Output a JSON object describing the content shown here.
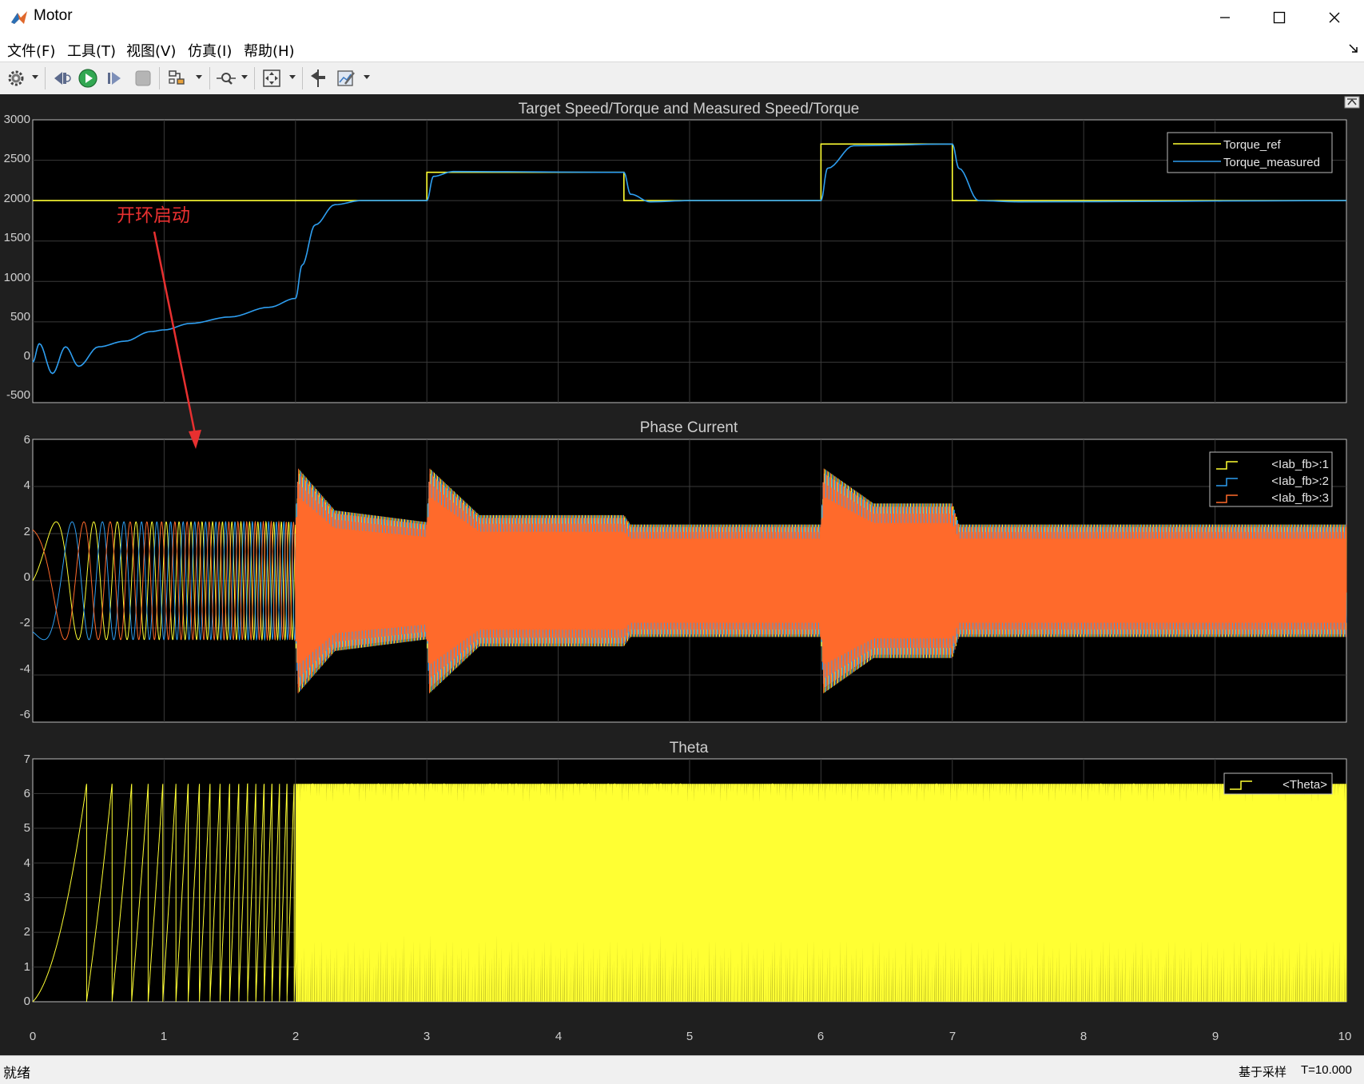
{
  "window": {
    "title": "Motor",
    "minimize_icon": "minimize-icon",
    "maximize_icon": "maximize-icon",
    "close_icon": "close-icon"
  },
  "menu": [
    "文件(F)",
    "工具(T)",
    "视图(V)",
    "仿真(I)",
    "帮助(H)"
  ],
  "toolbar": {
    "icons": [
      "gear-icon",
      "step-back-icon",
      "run-icon",
      "step-forward-icon",
      "stop-icon",
      "highlight-icon",
      "zoom-icon",
      "fit-view-icon",
      "cursor-icon",
      "style-icon"
    ]
  },
  "annotation": {
    "text": "开环启动",
    "color": "#e83030"
  },
  "plots": [
    {
      "title": "Target Speed/Torque and Measured Speed/Torque",
      "ylim": [
        -500,
        3000
      ],
      "yticks": [
        "3000",
        "2500",
        "2000",
        "1500",
        "1000",
        "500",
        "0",
        "-500"
      ],
      "legend": [
        {
          "label": "Torque_ref",
          "color": "#ffff33"
        },
        {
          "label": "Torque_measured",
          "color": "#2e9ef0"
        }
      ]
    },
    {
      "title": "Phase Current",
      "ylim": [
        -6,
        6
      ],
      "yticks": [
        "6",
        "4",
        "2",
        "0",
        "-2",
        "-4",
        "-6"
      ],
      "legend": [
        {
          "label": "<Iab_fb>:1",
          "color": "#ffff33"
        },
        {
          "label": "<Iab_fb>:2",
          "color": "#2e9ef0"
        },
        {
          "label": "<Iab_fb>:3",
          "color": "#ff6a2b"
        }
      ]
    },
    {
      "title": "Theta",
      "ylim": [
        0,
        7
      ],
      "yticks": [
        "7",
        "6",
        "5",
        "4",
        "3",
        "2",
        "1",
        "0"
      ],
      "legend": [
        {
          "label": "<Theta>",
          "color": "#ffff33"
        }
      ]
    }
  ],
  "xaxis": {
    "ticks": [
      "0",
      "1",
      "2",
      "3",
      "4",
      "5",
      "6",
      "7",
      "8",
      "9",
      "10"
    ],
    "xlim": [
      0,
      10
    ]
  },
  "status": {
    "left": "就绪",
    "sample": "基于采样",
    "time": "T=10.000"
  },
  "chart_data": [
    {
      "type": "line",
      "title": "Target Speed/Torque and Measured Speed/Torque",
      "xlim": [
        0,
        10
      ],
      "ylim": [
        -500,
        3000
      ],
      "grid": true,
      "legend_position": "top-right",
      "series": [
        {
          "name": "Torque_ref",
          "color": "#ffff33",
          "x": [
            0,
            3,
            3,
            4.5,
            4.5,
            6,
            6,
            7,
            7,
            10
          ],
          "y": [
            2000,
            2000,
            2350,
            2350,
            2000,
            2000,
            2700,
            2700,
            2000,
            2000
          ]
        },
        {
          "name": "Torque_measured",
          "color": "#2e9ef0",
          "x": [
            0,
            0.05,
            0.15,
            0.25,
            0.35,
            0.5,
            0.7,
            0.9,
            1.0,
            1.2,
            1.5,
            1.8,
            2.0,
            2.05,
            2.15,
            2.3,
            2.5,
            3.0,
            3.05,
            3.2,
            4.5,
            4.55,
            4.7,
            5.0,
            6.0,
            6.05,
            6.25,
            7.0,
            7.05,
            7.2,
            7.5,
            10.0
          ],
          "y": [
            0,
            230,
            -140,
            190,
            -50,
            190,
            260,
            380,
            400,
            480,
            560,
            680,
            790,
            1200,
            1700,
            1950,
            2000,
            2000,
            2300,
            2360,
            2350,
            2080,
            1985,
            2000,
            2000,
            2400,
            2680,
            2700,
            2400,
            2000,
            1985,
            2000
          ]
        }
      ]
    },
    {
      "type": "line",
      "title": "Phase Current",
      "xlim": [
        0,
        10
      ],
      "ylim": [
        -6,
        6
      ],
      "grid": true,
      "legend_position": "top-right",
      "series": [
        {
          "name": "<Iab_fb>:1",
          "color": "#ffff33",
          "description_amplitude_envelope": {
            "x": [
              0,
              2,
              2.02,
              2.3,
              3.0,
              3.02,
              3.4,
              4.5,
              4.55,
              6.0,
              6.02,
              6.4,
              7.0,
              7.05,
              10.0
            ],
            "y": [
              2.5,
              2.5,
              4.8,
              3.0,
              2.5,
              4.8,
              2.8,
              2.8,
              2.4,
              2.4,
              4.8,
              3.3,
              3.3,
              2.4,
              2.4
            ]
          }
        },
        {
          "name": "<Iab_fb>:2",
          "color": "#2e9ef0"
        },
        {
          "name": "<Iab_fb>:3",
          "color": "#ff6a2b"
        }
      ]
    },
    {
      "type": "line",
      "title": "Theta",
      "xlim": [
        0,
        10
      ],
      "ylim": [
        0,
        7
      ],
      "grid": true,
      "legend_position": "top-right",
      "series": [
        {
          "name": "<Theta>",
          "color": "#ffff33",
          "y_range": [
            0,
            6.28
          ]
        }
      ]
    }
  ]
}
